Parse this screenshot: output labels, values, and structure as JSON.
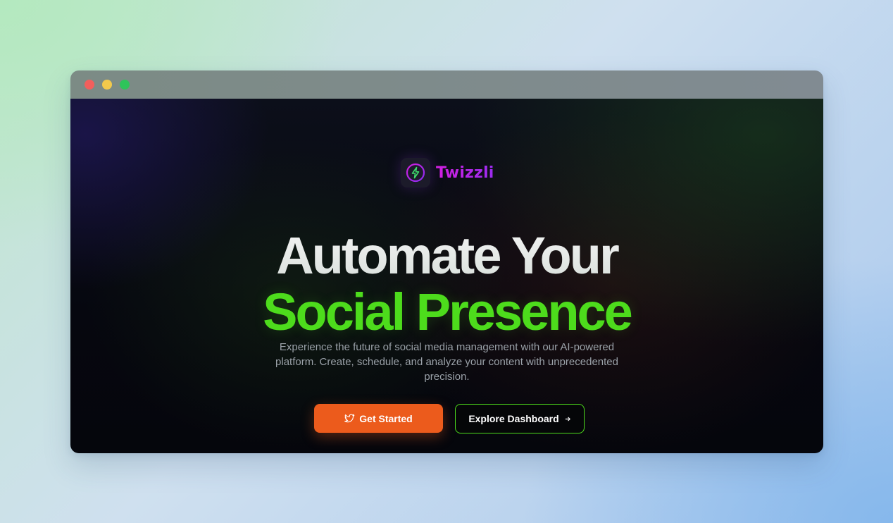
{
  "window": {
    "traffic_lights": [
      "close",
      "minimize",
      "maximize"
    ]
  },
  "brand": {
    "name": "Twizzli",
    "logo_icon": "lightning-bolt-icon"
  },
  "hero": {
    "headline_line1": "Automate Your",
    "headline_line2": "Social Presence",
    "subtitle": "Experience the future of social media management with our AI-powered platform. Create, schedule, and analyze your content with unprecedented precision."
  },
  "actions": {
    "primary_label": "Get Started",
    "primary_icon": "twitter-bird-icon",
    "secondary_label": "Explore Dashboard",
    "secondary_icon": "arrow-right-icon"
  },
  "colors": {
    "accent_green": "#4ddc1c",
    "accent_orange": "#ec5b1c",
    "brand_purple": "#c020e8"
  }
}
